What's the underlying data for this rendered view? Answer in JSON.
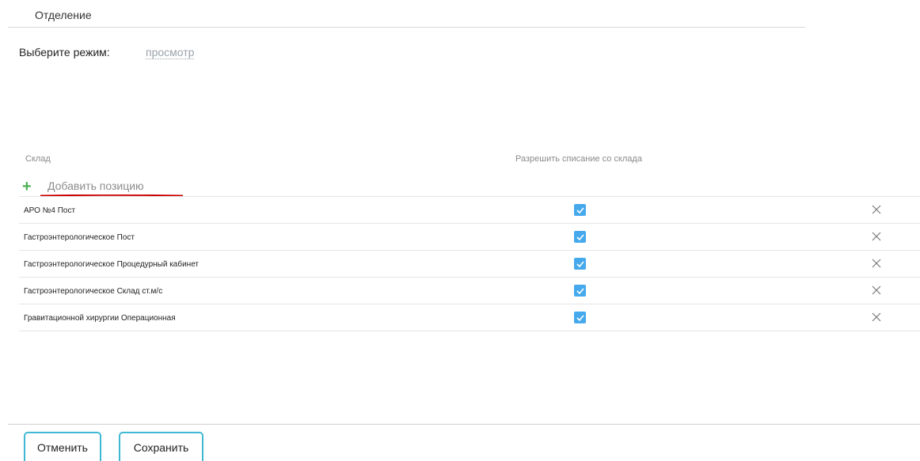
{
  "section": {
    "title": "Отделение"
  },
  "mode": {
    "label": "Выберите режим:",
    "value": "просмотр"
  },
  "table": {
    "columns": [
      "Склад",
      "Разрешить списание со склада"
    ],
    "add_label": "Добавить позицию",
    "rows": [
      {
        "name": "АРО №4 Пост",
        "allowed": true
      },
      {
        "name": "Гастроэнтерологическое Пост",
        "allowed": true
      },
      {
        "name": "Гастроэнтерологическое Процедурный кабинет",
        "allowed": true
      },
      {
        "name": "Гастроэнтерологическое Склад ст.м/с",
        "allowed": true
      },
      {
        "name": "Гравитационной хирургии Операционная",
        "allowed": true
      }
    ]
  },
  "icons": {
    "add": "plus-icon",
    "check": "checkmark-icon",
    "remove": "close-icon"
  },
  "colors": {
    "accent": "#46a9ec",
    "add": "#4caf50",
    "button_border": "#3fb8d4",
    "highlight": "#cc0000"
  },
  "footer": {
    "cancel_label": "Отменить",
    "save_label": "Сохранить"
  }
}
